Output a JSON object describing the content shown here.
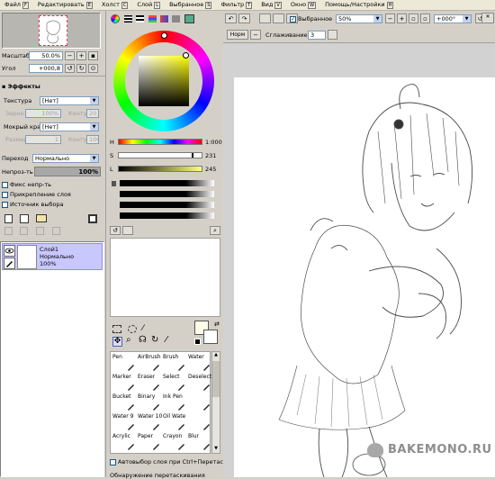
{
  "menu": [
    {
      "label": "Файл",
      "key": "F"
    },
    {
      "label": "Редактировать",
      "key": "E"
    },
    {
      "label": "Холст",
      "key": "C"
    },
    {
      "label": "Слой",
      "key": "L"
    },
    {
      "label": "Выбранное",
      "key": "S"
    },
    {
      "label": "Фильтр",
      "key": "T"
    },
    {
      "label": "Вид",
      "key": "V"
    },
    {
      "label": "Окно",
      "key": "W"
    },
    {
      "label": "Помощь/Настройки",
      "key": "H"
    }
  ],
  "navigator": {
    "zoom_label": "Масштаб",
    "zoom_value": "50.0%",
    "angle_label": "Угол",
    "angle_value": "+000,8"
  },
  "effects": {
    "title": "Эффекты",
    "texture_label": "Текстура",
    "texture_value": "[Нет]",
    "grain_label": "Зерно",
    "grain_value": "100%",
    "contrast_label": "Конту",
    "contrast_value": "20",
    "wet_edge_label": "Мокрый край",
    "wet_edge_value": "[Нет]",
    "size_label": "Размер",
    "size_value": "1",
    "strength_label": "Конту",
    "strength_value": "100"
  },
  "layer_props": {
    "mode_label": "Переход",
    "mode_value": "Нормально",
    "opacity_label": "Непроз-ть",
    "opacity_value": "100%",
    "check_opacity": "Фикс непр-ть",
    "check_clip": "Прикрепление слоя",
    "check_source": "Источник выбора"
  },
  "layer": {
    "name": "Слой1",
    "mode": "Нормально",
    "opacity": "100%"
  },
  "color": {
    "h_label": "H",
    "h_value": "1:000",
    "s_label": "S",
    "s_value": "231",
    "l_label": "L",
    "l_value": "245",
    "primary": "#fffde8",
    "secondary": "#ffffff"
  },
  "toolbar": {
    "selection_label": "Выбранное",
    "zoom_value": "50%",
    "angle_value": "+000°",
    "norm_label": "Норм",
    "smoothing_label": "Сглаживание",
    "smoothing_value": "3"
  },
  "tools": [
    [
      "Pen",
      "AirBrush",
      "Brush",
      "Water"
    ],
    [
      "Marker",
      "Eraser",
      "Select",
      "Deselect"
    ],
    [
      "Bucket",
      "Binary",
      "Ink Pen",
      ""
    ],
    [
      "Water 9",
      "Water 10",
      "Oil Wate",
      ""
    ],
    [
      "Acrylic",
      "Paper",
      "Crayon",
      "Blur"
    ]
  ],
  "bottom": {
    "autoselect": "Автовыбор слоя при Ctrl+Перетаскив",
    "drag_label": "Обнаружение перетаскивания"
  },
  "watermark": "BAKEMONO.RU"
}
